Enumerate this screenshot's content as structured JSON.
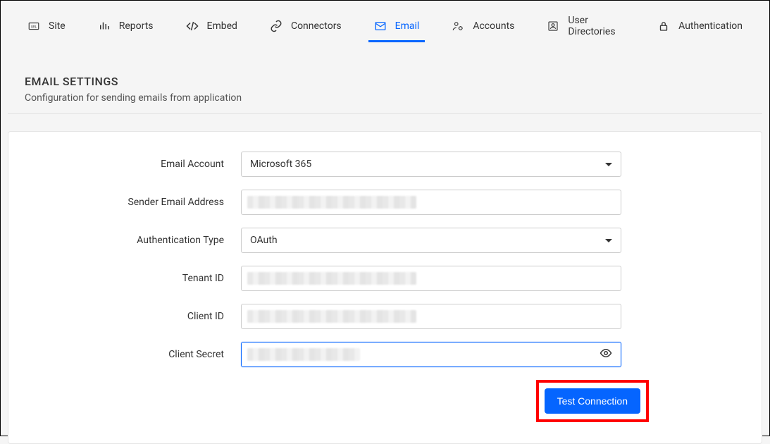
{
  "tabs": {
    "site": "Site",
    "reports": "Reports",
    "embed": "Embed",
    "connectors": "Connectors",
    "email": "Email",
    "accounts": "Accounts",
    "user_directories": "User Directories",
    "authentication": "Authentication"
  },
  "section": {
    "title": "EMAIL SETTINGS",
    "description": "Configuration for sending emails from application"
  },
  "form": {
    "email_account_label": "Email Account",
    "email_account_value": "Microsoft 365",
    "sender_email_label": "Sender Email Address",
    "sender_email_value": "",
    "auth_type_label": "Authentication Type",
    "auth_type_value": "OAuth",
    "tenant_id_label": "Tenant ID",
    "tenant_id_value": "",
    "client_id_label": "Client ID",
    "client_id_value": "",
    "client_secret_label": "Client Secret",
    "client_secret_value": "",
    "test_connection_label": "Test Connection"
  }
}
